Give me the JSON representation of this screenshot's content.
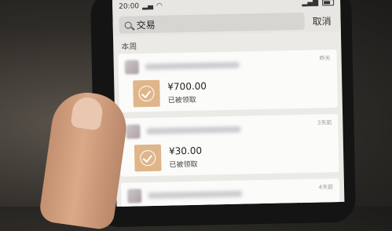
{
  "status_bar": {
    "time": "20:00"
  },
  "search": {
    "value": "交易",
    "cancel_label": "取消"
  },
  "section_title": "本周",
  "transactions": [
    {
      "time": "昨天",
      "amount": "¥700.00",
      "status": "已被领取"
    },
    {
      "time": "3天前",
      "amount": "¥30.00",
      "status": "已被领取"
    },
    {
      "time": "4天前"
    }
  ]
}
